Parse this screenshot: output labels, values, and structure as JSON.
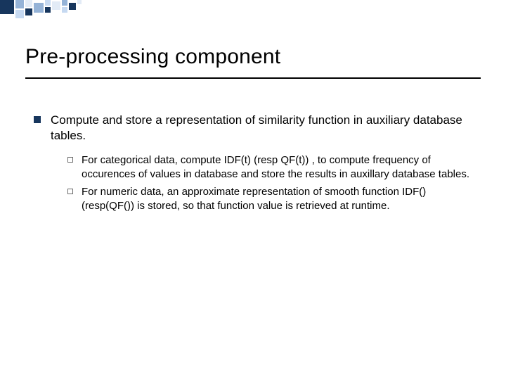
{
  "title": "Pre-processing component",
  "main": {
    "text": "Compute and store a representation of similarity function in auxiliary database tables.",
    "sub": [
      "For categorical data, compute IDF(t) (resp QF(t)) , to compute frequency of occurences of values in database and store the results in auxillary database tables.",
      "For numeric data, an approximate representation of smooth function IDF() (resp(QF()) is stored, so that function value is retrieved at runtime."
    ]
  },
  "colors": {
    "accent_dark": "#17365d",
    "accent_mid": "#95b3d7",
    "accent_light": "#c6d9f1",
    "accent_pale": "#e2ebf6"
  }
}
